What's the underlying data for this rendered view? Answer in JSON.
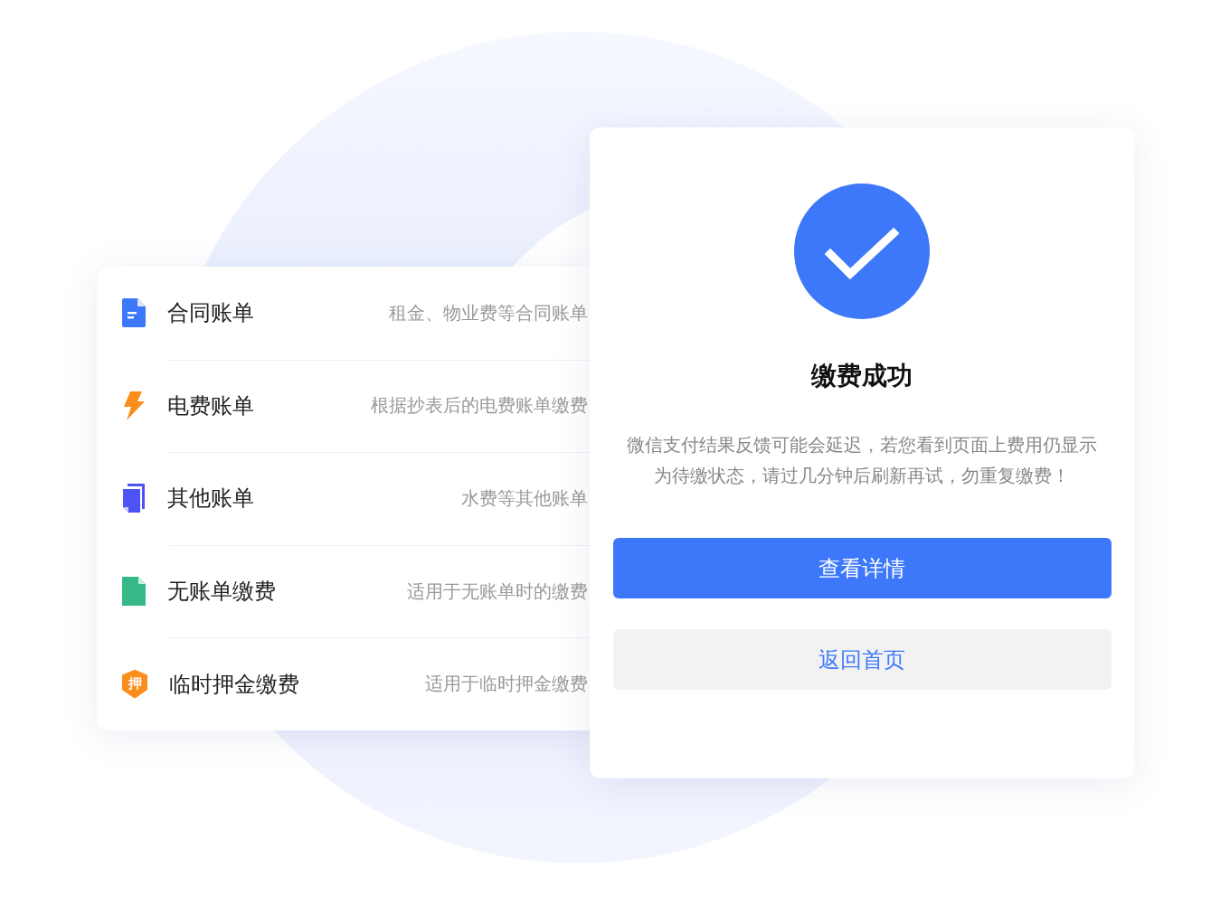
{
  "bill_types": [
    {
      "kind": "document",
      "title": "合同账单",
      "description": "租金、物业费等合同账单"
    },
    {
      "kind": "bolt",
      "title": "电费账单",
      "description": "根据抄表后的电费账单缴费"
    },
    {
      "kind": "copies",
      "title": "其他账单",
      "description": "水费等其他账单"
    },
    {
      "kind": "file",
      "title": "无账单缴费",
      "description": "适用于无账单时的缴费"
    },
    {
      "kind": "shield",
      "badge": "押",
      "title": "临时押金缴费",
      "description": "适用于临时押金缴费"
    }
  ],
  "result": {
    "title": "缴费成功",
    "message": "微信支付结果反馈可能会延迟，若您看到页面上费用仍显示为待缴状态，请过几分钟后刷新再试，勿重复缴费！",
    "buttons": [
      {
        "kind": "primary",
        "label": "查看详情"
      },
      {
        "kind": "secondary",
        "label": "返回首页"
      }
    ]
  }
}
